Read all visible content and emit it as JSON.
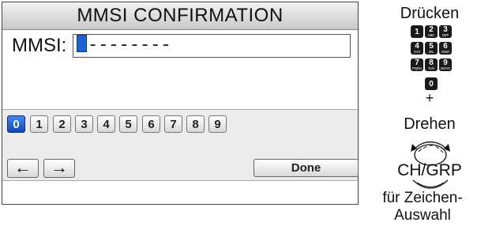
{
  "screen": {
    "title": "MMSI CONFIRMATION",
    "mmsi_label": "MMSI:",
    "mmsi_value": "--------",
    "digits": [
      "0",
      "1",
      "2",
      "3",
      "4",
      "5",
      "6",
      "7",
      "8",
      "9"
    ],
    "selected_digit": "0",
    "left_arrow": "←",
    "right_arrow": "→",
    "done_label": "Done"
  },
  "instructions": {
    "press": "Drücken",
    "plus": "+",
    "turn": "Drehen",
    "knob_label": "CH/GRP",
    "for_line1": "für Zeichen-",
    "for_line2": "Auswahl",
    "keys": [
      {
        "num": "1",
        "letters": ""
      },
      {
        "num": "2",
        "letters": "ABC"
      },
      {
        "num": "3",
        "letters": "DEF"
      },
      {
        "num": "4",
        "letters": "GHI"
      },
      {
        "num": "5",
        "letters": "JKL"
      },
      {
        "num": "6",
        "letters": "MNO"
      },
      {
        "num": "7",
        "letters": "PQRS"
      },
      {
        "num": "8",
        "letters": "TUV"
      },
      {
        "num": "9",
        "letters": "WXYZ"
      },
      {
        "num": "0",
        "letters": ""
      }
    ]
  },
  "colors": {
    "selection": "#1d63d8",
    "key_background": "#1a1a1a"
  }
}
